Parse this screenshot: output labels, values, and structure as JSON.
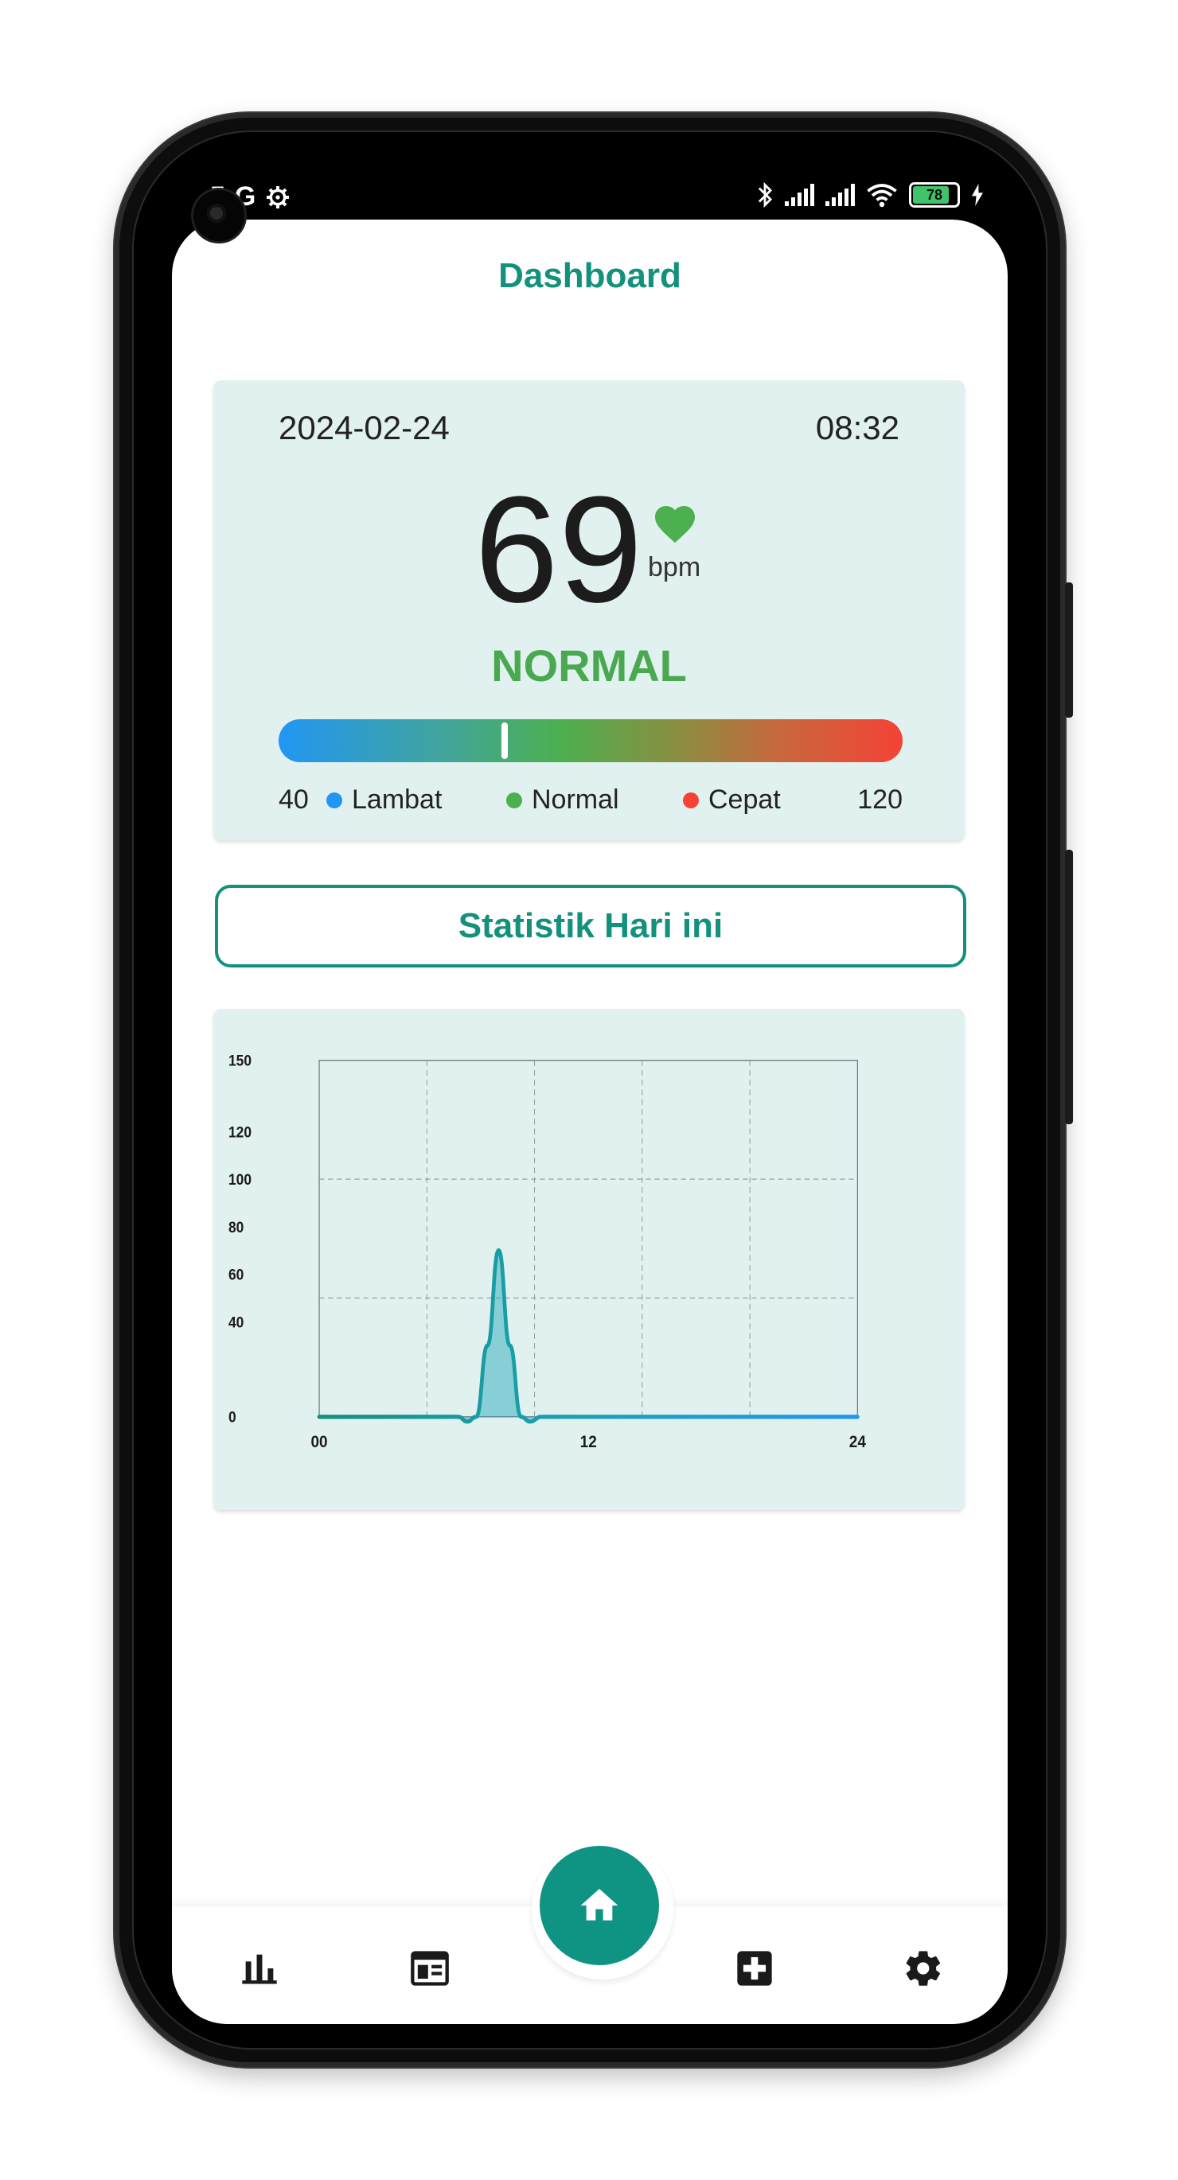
{
  "status_bar": {
    "time_fragment": "5",
    "network": "G",
    "battery_level": "78",
    "settings_icon": "gear-icon",
    "right_icons": [
      "bluetooth-icon",
      "signal-icon",
      "signal-icon",
      "wifi-icon",
      "battery-icon",
      "charging-icon"
    ]
  },
  "header": {
    "title": "Dashboard"
  },
  "heart_card": {
    "date": "2024-02-24",
    "time": "08:32",
    "bpm": "69",
    "unit": "bpm",
    "status": "NORMAL",
    "status_color": "#4aa851",
    "gauge": {
      "min": "40",
      "max": "120",
      "value": 69
    },
    "legend": [
      {
        "label": "Lambat",
        "color": "#2196f3"
      },
      {
        "label": "Normal",
        "color": "#4caf50"
      },
      {
        "label": "Cepat",
        "color": "#f44336"
      }
    ]
  },
  "stats_button": {
    "label": "Statistik Hari ini"
  },
  "chart_data": {
    "type": "line",
    "x": [
      0,
      5.0,
      6.2,
      6.6,
      7.0,
      7.5,
      8.0,
      8.5,
      9.0,
      9.4,
      9.9,
      10.4,
      24
    ],
    "y": [
      0,
      0,
      0,
      -2,
      0,
      30,
      70,
      30,
      0,
      -2,
      0,
      0,
      0
    ],
    "xlim": [
      0,
      24
    ],
    "ylim": [
      0,
      150
    ],
    "x_ticks": [
      "00",
      "12",
      "24"
    ],
    "y_ticks": [
      "0",
      "40",
      "60",
      "80",
      "100",
      "120",
      "150"
    ],
    "grid": true,
    "line_colors": [
      "#13917d",
      "#1aa3b8",
      "#2196f3"
    ]
  },
  "bottom_nav": {
    "items": [
      {
        "name": "nav-stats",
        "icon": "bar-chart-icon"
      },
      {
        "name": "nav-calendar",
        "icon": "calendar-icon"
      },
      {
        "name": "nav-home",
        "icon": "home-icon"
      },
      {
        "name": "nav-medical",
        "icon": "medical-plus-icon"
      },
      {
        "name": "nav-settings",
        "icon": "gear-icon"
      }
    ]
  }
}
